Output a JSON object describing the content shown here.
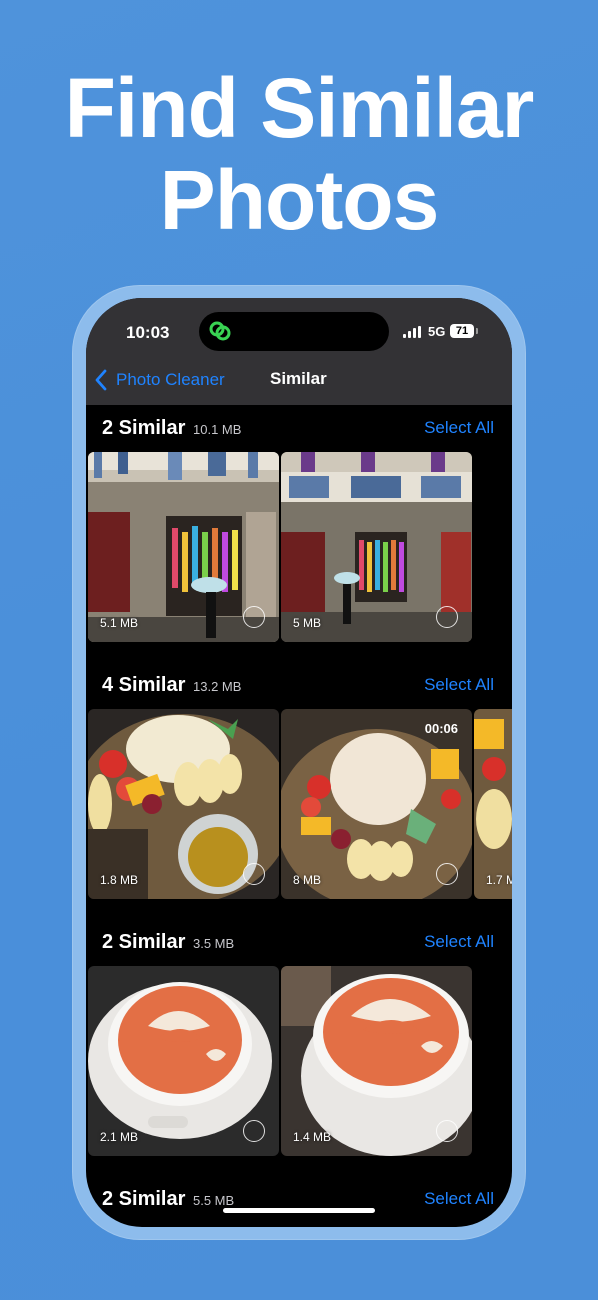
{
  "headline": {
    "line1": "Find Similar",
    "line2": "Photos"
  },
  "status_bar": {
    "time": "10:03",
    "network": "5G",
    "battery": "71"
  },
  "nav": {
    "back_label": "Photo Cleaner",
    "title": "Similar"
  },
  "groups": [
    {
      "title": "2 Similar",
      "size": "10.1 MB",
      "select_all": "Select All",
      "photos": [
        {
          "size": "5.1 MB"
        },
        {
          "size": "5 MB"
        }
      ]
    },
    {
      "title": "4 Similar",
      "size": "13.2 MB",
      "select_all": "Select All",
      "photos": [
        {
          "size": "1.8 MB"
        },
        {
          "size": "8 MB",
          "duration": "00:06"
        },
        {
          "size": "1.7 M"
        }
      ]
    },
    {
      "title": "2 Similar",
      "size": "3.5 MB",
      "select_all": "Select All",
      "photos": [
        {
          "size": "2.1 MB"
        },
        {
          "size": "1.4 MB"
        }
      ]
    },
    {
      "title": "2 Similar",
      "size": "5.5 MB",
      "select_all": "Select All",
      "photos": []
    }
  ],
  "colors": {
    "accent": "#1f83ff",
    "background": "#4a8fda",
    "nav_bar": "#333235"
  },
  "icons": [
    "chevron-left-icon",
    "link-icon",
    "signal-icon",
    "battery-icon",
    "select-circle-icon"
  ]
}
